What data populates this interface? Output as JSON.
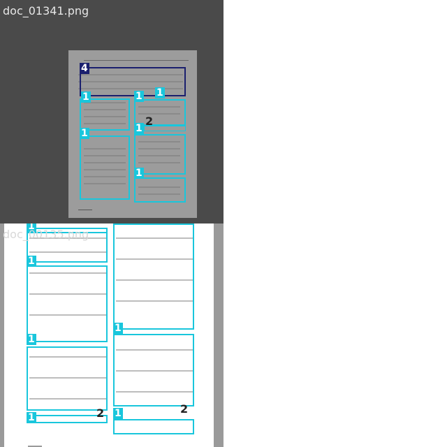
{
  "panels": [
    {
      "filename": "doc_01341.png",
      "regions": [
        {
          "label": "4",
          "kind": "table"
        },
        {
          "label": "1",
          "kind": "text"
        },
        {
          "label": "1",
          "kind": "text"
        },
        {
          "label": "1",
          "kind": "text"
        },
        {
          "label": "2",
          "kind": "caption"
        },
        {
          "label": "1",
          "kind": "text"
        },
        {
          "label": "1",
          "kind": "text"
        },
        {
          "label": "1",
          "kind": "text"
        }
      ]
    },
    {
      "filename": "doc_00135.png",
      "regions": [
        {
          "label": "1",
          "kind": "text"
        },
        {
          "label": "1",
          "kind": "text"
        },
        {
          "label": "1",
          "kind": "text"
        },
        {
          "label": "1",
          "kind": "text"
        },
        {
          "label": "1",
          "kind": "text"
        },
        {
          "label": "1",
          "kind": "text"
        },
        {
          "label": "1",
          "kind": "text"
        },
        {
          "label": "1",
          "kind": "text"
        },
        {
          "label": "2",
          "kind": "caption"
        },
        {
          "label": "2",
          "kind": "caption"
        }
      ]
    }
  ],
  "colors": {
    "text_box": "#19c6dc",
    "table_box": "#1a1f6e",
    "panel_bg": "#4a4a4a",
    "page_bg": "#9c9c9c"
  }
}
